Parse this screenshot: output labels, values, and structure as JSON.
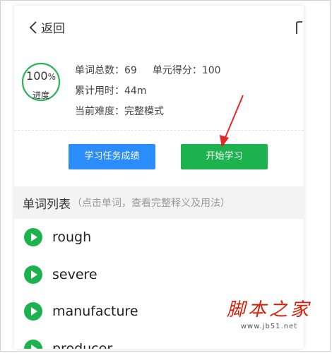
{
  "header": {
    "back_label": "返回"
  },
  "progress": {
    "value": "100",
    "unit": "%",
    "percent": 100,
    "label": "进度",
    "ring_color": "#2bb55a"
  },
  "stats": {
    "total_words_label": "单词总数：",
    "total_words_value": "69",
    "unit_score_label": "单元得分：",
    "unit_score_value": "100",
    "time_used_label": "累计用时：",
    "time_used_value": "44m",
    "difficulty_label": "当前难度：",
    "difficulty_value": "完整模式"
  },
  "buttons": {
    "scores_label": "学习任务成绩",
    "start_label": "开始学习",
    "scores_color": "#2a8dfb",
    "start_color": "#1cb34f"
  },
  "word_list": {
    "title": "单词列表",
    "hint": "（点击单词，查看完整释义及用法）",
    "items": [
      {
        "word": "rough"
      },
      {
        "word": "severe"
      },
      {
        "word": "manufacture"
      },
      {
        "word": "producer"
      }
    ]
  },
  "watermark": {
    "name": "脚本之家",
    "url": "www.jb51.net"
  },
  "icons": {
    "back": "chevron-left-icon",
    "share": "share-icon",
    "play": "play-circle-icon",
    "arrow": "annotation-arrow-icon"
  },
  "colors": {
    "play_green": "#1cb34f",
    "annotation_red": "#e8262a"
  }
}
